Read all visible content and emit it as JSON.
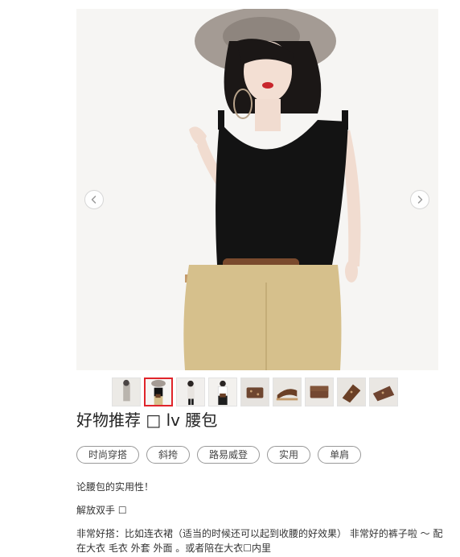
{
  "gallery": {
    "prev_icon": "chevron-left-icon",
    "next_icon": "chevron-right-icon",
    "thumbnail_count": 9,
    "active_thumbnail": 2,
    "active_border_color": "#e0242b"
  },
  "article": {
    "title": "好物推荐 □ lv 腰包",
    "tags": [
      "时尚穿搭",
      "斜挎",
      "路易威登",
      "实用",
      "单肩"
    ],
    "paragraphs": [
      "论腰包的实用性！",
      "解放双手 ☐",
      "非常好搭：比如连衣裙（适当的时候还可以起到收腰的好效果） 非常好的裤子啦 ～ 配在大衣 毛衣 外套 外面 。或者陪在大衣☐内里"
    ]
  }
}
